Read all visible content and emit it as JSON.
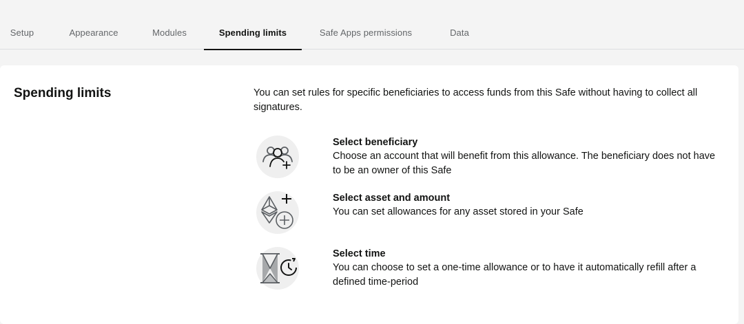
{
  "tabs": [
    {
      "label": "Setup"
    },
    {
      "label": "Appearance"
    },
    {
      "label": "Modules"
    },
    {
      "label": "Spending limits",
      "active": true
    },
    {
      "label": "Safe Apps permissions"
    },
    {
      "label": "Data"
    }
  ],
  "section": {
    "title": "Spending limits",
    "intro": "You can set rules for specific beneficiaries to access funds from this Safe without having to collect all signatures."
  },
  "steps": [
    {
      "icon": "beneficiary-icon",
      "title": "Select beneficiary",
      "description": "Choose an account that will benefit from this allowance. The beneficiary does not have to be an owner of this Safe"
    },
    {
      "icon": "asset-amount-icon",
      "title": "Select asset and amount",
      "description": "You can set allowances for any asset stored in your Safe"
    },
    {
      "icon": "time-icon",
      "title": "Select time",
      "description": "You can choose to set a one-time allowance or to have it automatically refill after a defined time-period"
    }
  ],
  "colors": {
    "text": "#121312",
    "muted": "#636669",
    "icon_bg": "#efefef",
    "icon_stroke": "#5b5f63",
    "card_bg": "#ffffff",
    "page_bg": "#f4f4f4"
  }
}
